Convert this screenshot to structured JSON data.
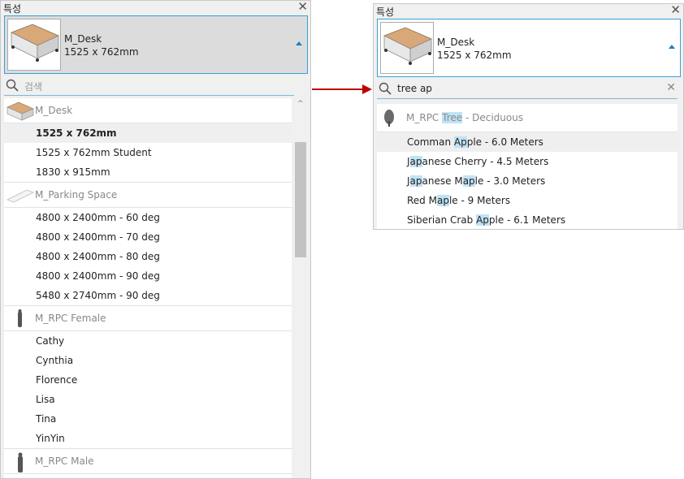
{
  "left": {
    "title": "특성",
    "selector": {
      "name": "M_Desk",
      "size": "1525 x 762mm"
    },
    "search_placeholder": "검색",
    "groups": [
      {
        "label": "M_Desk",
        "items": [
          "1525 x 762mm",
          "1525 x 762mm Student",
          "1830 x 915mm"
        ]
      },
      {
        "label": "M_Parking Space",
        "items": [
          "4800 x 2400mm - 60 deg",
          "4800 x 2400mm - 70 deg",
          "4800 x 2400mm - 80 deg",
          "4800 x 2400mm - 90 deg",
          "5480 x 2740mm - 90 deg"
        ]
      },
      {
        "label": "M_RPC Female",
        "items": [
          "Cathy",
          "Cynthia",
          "Florence",
          "Lisa",
          "Tina",
          "YinYin"
        ]
      },
      {
        "label": "M_RPC Male"
      }
    ]
  },
  "right": {
    "title": "특성",
    "selector": {
      "name": "M_Desk",
      "size": "1525 x 762mm"
    },
    "search_value": "tree ap",
    "group": {
      "label_pre": "M_RPC ",
      "label_hl": "Tree",
      "label_post": " - Deciduous"
    },
    "items": [
      {
        "pre": "Comman ",
        "hl": "Ap",
        "post": "ple - 6.0 Meters"
      },
      {
        "pre": "J",
        "hl": "ap",
        "post": "anese Cherry - 4.5 Meters"
      },
      {
        "pre": "J",
        "hl": "ap",
        "post": "anese M",
        "hl2": "ap",
        "post2": "le - 3.0 Meters"
      },
      {
        "pre": "Red M",
        "hl": "ap",
        "post": "le - 9 Meters"
      },
      {
        "pre": "Siberian Crab ",
        "hl": "Ap",
        "post": "ple - 6.1 Meters"
      }
    ]
  }
}
